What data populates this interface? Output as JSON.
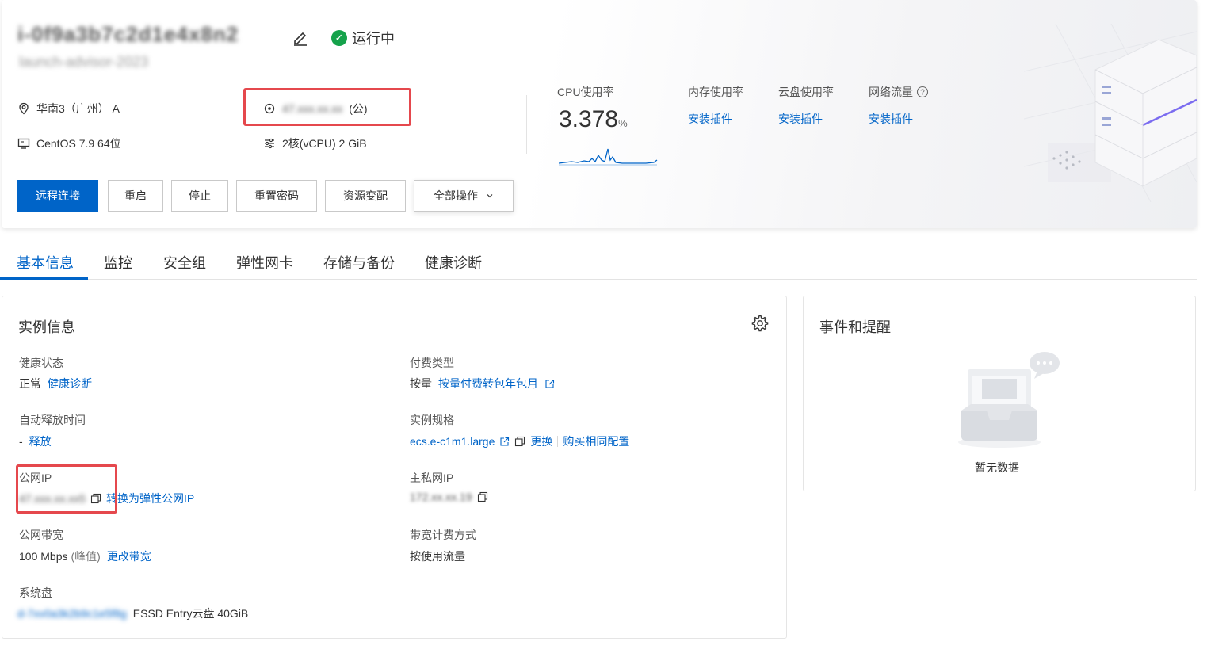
{
  "instance": {
    "name": "i-0f9a3b7c2d1e4x8n2",
    "id": "launch-advisor-2023",
    "status": "运行中"
  },
  "meta": {
    "region": "华南3（广州） A",
    "public_ip": "47.xxx.xx.xx",
    "public_ip_suffix": "(公)",
    "os": "CentOS 7.9 64位",
    "spec": "2核(vCPU)  2 GiB"
  },
  "metrics": {
    "cpu": {
      "label": "CPU使用率",
      "value": "3.378",
      "unit": "%"
    },
    "memory": {
      "label": "内存使用率",
      "action": "安装插件"
    },
    "disk": {
      "label": "云盘使用率",
      "action": "安装插件"
    },
    "network": {
      "label": "网络流量",
      "action": "安装插件"
    }
  },
  "actions": [
    "远程连接",
    "重启",
    "停止",
    "重置密码",
    "资源变配",
    "全部操作"
  ],
  "tabs": [
    "基本信息",
    "监控",
    "安全组",
    "弹性网卡",
    "存储与备份",
    "健康诊断"
  ],
  "instance_info": {
    "title": "实例信息",
    "health_label": "健康状态",
    "health_value": "正常",
    "health_link": "健康诊断",
    "release_label": "自动释放时间",
    "release_value": "-",
    "release_link": "释放",
    "pubip_label": "公网IP",
    "pubip_value": "47.xxx.xx.xx5",
    "pubip_link": "转换为弹性公网IP",
    "bw_label": "公网带宽",
    "bw_value": "100 Mbps",
    "bw_note": "(峰值)",
    "bw_link": "更改带宽",
    "sysdisk_label": "系统盘",
    "sysdisk_id": "d-7xv0a3k2b9c1e5f8g",
    "sysdisk_value": "ESSD Entry云盘  40GiB",
    "pay_label": "付费类型",
    "pay_value": "按量",
    "pay_link": "按量付费转包年包月",
    "type_label": "实例规格",
    "type_value": "ecs.e-c1m1.large",
    "type_link1": "更换",
    "type_link2": "购买相同配置",
    "privip_label": "主私网IP",
    "privip_value": "172.xx.xx.19",
    "bwpay_label": "带宽计费方式",
    "bwpay_value": "按使用流量"
  },
  "events": {
    "title": "事件和提醒",
    "empty": "暂无数据"
  },
  "colors": {
    "primary": "#0064c8",
    "success": "#15a24b",
    "highlight": "#e5484d"
  }
}
